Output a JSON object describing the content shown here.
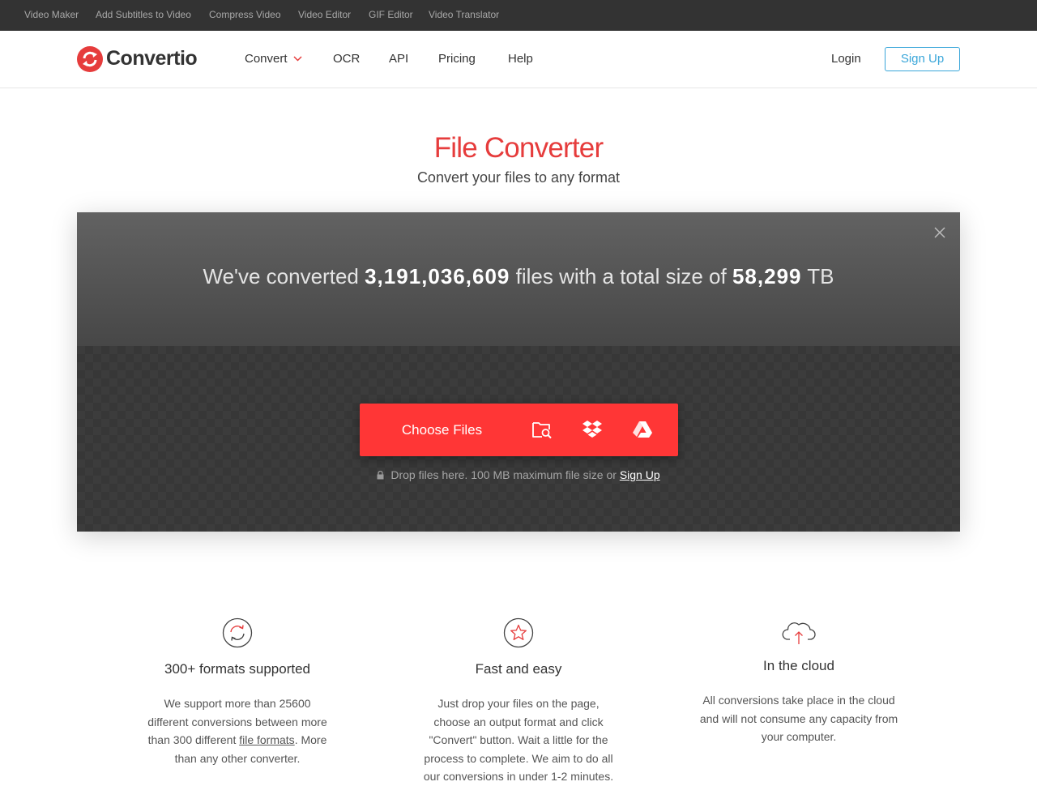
{
  "topbar": {
    "links": [
      "Video Maker",
      "Add Subtitles to Video",
      "Compress Video",
      "Video Editor",
      "GIF Editor",
      "Video Translator"
    ]
  },
  "header": {
    "logo_text": "Convertio",
    "nav": [
      "Convert",
      "OCR",
      "API",
      "Pricing",
      "Help"
    ],
    "login": "Login",
    "signup": "Sign Up"
  },
  "hero": {
    "title": "File Converter",
    "subtitle": "Convert your files to any format"
  },
  "converter": {
    "stats_prefix": "We've converted",
    "files_count": "3,191,036,609",
    "stats_middle": "files with a total size of",
    "total_size": "58,299",
    "size_unit": "TB",
    "choose_files": "Choose Files",
    "sources": [
      "folder-search-icon",
      "dropbox-icon",
      "google-drive-icon"
    ],
    "drop_note": "Drop files here. 100 MB maximum file size or",
    "drop_link": "Sign Up"
  },
  "features": [
    {
      "icon": "refresh-circle-icon",
      "title": "300+ formats supported",
      "text_before": "We support more than 25600 different conversions between more than 300 different",
      "link": "file formats",
      "text_after": ". More than any other converter."
    },
    {
      "icon": "star-circle-icon",
      "title": "Fast and easy",
      "text": "Just drop your files on the page, choose an output format and click \"Convert\" button. Wait a little for the process to complete. We aim to do all our conversions in under 1-2 minutes."
    },
    {
      "icon": "cloud-upload-icon",
      "title": "In the cloud",
      "text": "All conversions take place in the cloud and will not consume any capacity from your computer."
    }
  ],
  "colors": {
    "brand_red": "#e63c3c",
    "button_red": "#ff3636",
    "signup_blue": "#39a6d9",
    "topbar_bg": "#333333"
  }
}
